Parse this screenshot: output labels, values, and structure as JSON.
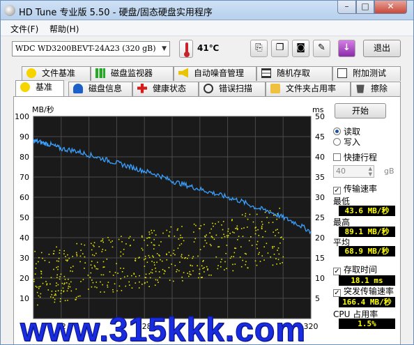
{
  "window": {
    "title": "HD Tune 专业版 5.50 - 硬盘/固态硬盘实用程序",
    "min": "–",
    "max": "□",
    "close": "✕"
  },
  "menu": [
    "文件(F)",
    "帮助(H)"
  ],
  "toolbar": {
    "drive": "WDC WD3200BEVT-24A23 (320 gB)",
    "temperature": "41℃",
    "exit_label": "退出"
  },
  "tabs_top": [
    "文件基准",
    "磁盘监视器",
    "自动噪音管理",
    "随机存取",
    "附加测试"
  ],
  "tabs_bottom": [
    "基准",
    "磁盘信息",
    "健康状态",
    "错误扫描",
    "文件夹占用率",
    "擦除"
  ],
  "chart_data": {
    "type": "scatter",
    "y_left_label": "MB/秒",
    "y_right_label": "ms",
    "y_left_ticks": [
      "100",
      "90",
      "80",
      "70",
      "60",
      "50",
      "40",
      "30",
      "20",
      "10"
    ],
    "y_right_ticks": [
      "50",
      "45",
      "40",
      "35",
      "30",
      "25",
      "20",
      "15",
      "10",
      "5"
    ],
    "x_ticks": [
      "0",
      "32",
      "128",
      "320"
    ],
    "ylim_left": [
      0,
      100
    ],
    "ylim_right": [
      0,
      50
    ],
    "xlim": [
      0,
      320
    ],
    "grid": true,
    "series": [
      {
        "name": "传输速率",
        "color": "#3aa0ff",
        "unit": "MB/秒",
        "x": [
          0,
          10,
          20,
          32,
          48,
          64,
          80,
          96,
          112,
          128,
          144,
          160,
          176,
          192,
          208,
          224,
          240,
          256,
          272,
          288,
          304,
          320
        ],
        "y": [
          88,
          87,
          86,
          84,
          83,
          81,
          79,
          77,
          75,
          73,
          71,
          68,
          66,
          64,
          62,
          60,
          58,
          55,
          53,
          50,
          47,
          43
        ]
      },
      {
        "name": "存取时间",
        "color": "#e6e600",
        "unit": "ms",
        "trend_x": [
          0,
          160,
          320
        ],
        "trend_y": [
          10,
          16,
          22
        ]
      }
    ]
  },
  "side": {
    "start_label": "开始",
    "read_label": "读取",
    "write_label": "写入",
    "short_stroke_label": "快捷行程",
    "short_stroke_value": "40",
    "short_stroke_unit": "gB",
    "transfer_rate_label": "传输速率",
    "min_label": "最低",
    "min_value": "43.6 MB/秒",
    "max_label": "最高",
    "max_value": "89.1 MB/秒",
    "avg_label": "平均",
    "avg_value": "68.9 MB/秒",
    "access_time_label": "存取时间",
    "access_time_value": "18.1 ms",
    "burst_label": "突发传输速率",
    "burst_value": "166.4 MB/秒",
    "cpu_label": "CPU 占用率",
    "cpu_value": "1.5%"
  },
  "watermark": "www.315kkk.com"
}
